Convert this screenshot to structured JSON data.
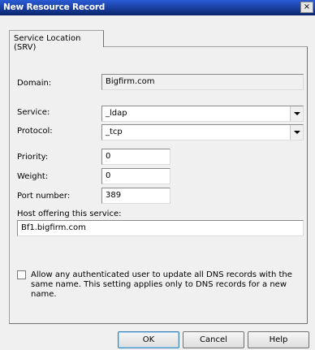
{
  "window": {
    "title": "New Resource Record",
    "close_glyph": "×"
  },
  "tabs": [
    {
      "label": "Service Location (SRV)"
    }
  ],
  "form": {
    "domain": {
      "label": "Domain:",
      "value": "Bigfirm.com"
    },
    "service": {
      "label": "Service:",
      "value": "_ldap"
    },
    "protocol": {
      "label": "Protocol:",
      "value": "_tcp"
    },
    "priority": {
      "label": "Priority:",
      "value": "0"
    },
    "weight": {
      "label": "Weight:",
      "value": "0"
    },
    "port": {
      "label": "Port number:",
      "value": "389"
    },
    "host": {
      "label": "Host offering this service:",
      "value": "Bf1.bigfirm.com"
    },
    "allow_update": {
      "checked": false,
      "label": "Allow any authenticated user to update all DNS records with the same name. This setting applies only to DNS records for a new name."
    }
  },
  "buttons": {
    "ok": "OK",
    "cancel": "Cancel",
    "help": "Help"
  }
}
